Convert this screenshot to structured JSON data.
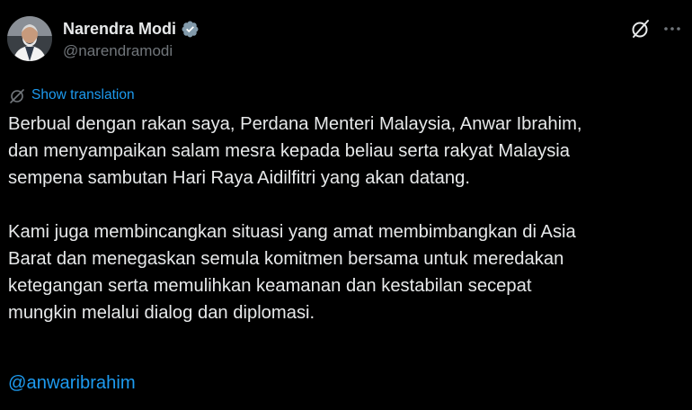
{
  "author": {
    "display_name": "Narendra Modi",
    "handle": "@narendramodi",
    "verified": true,
    "avatar_icon": "avatar-photo-icon"
  },
  "actions": {
    "grok_icon": "grok-slash-icon",
    "more_icon": "more-dots-icon"
  },
  "translate": {
    "label": "Show translation",
    "icon": "translate-globe-icon"
  },
  "tweet": {
    "paragraphs": [
      "Berbual dengan rakan saya, Perdana Menteri Malaysia, Anwar Ibrahim,\ndan menyampaikan salam mesra kepada beliau serta rakyat Malaysia\nsempena sambutan Hari Raya Aidilfitri yang akan datang.",
      "Kami juga membincangkan situasi yang amat membimbangkan di Asia\nBarat dan menegaskan semula komitmen bersama untuk meredakan\nketegangan serta memulihkan keamanan dan kestabilan secepat\nmungkin melalui dialog dan diplomasi."
    ],
    "mention": "@anwaribrahim"
  },
  "colors": {
    "background": "#000000",
    "text": "#e7e9ea",
    "muted": "#71767b",
    "accent": "#1d9bf0"
  }
}
